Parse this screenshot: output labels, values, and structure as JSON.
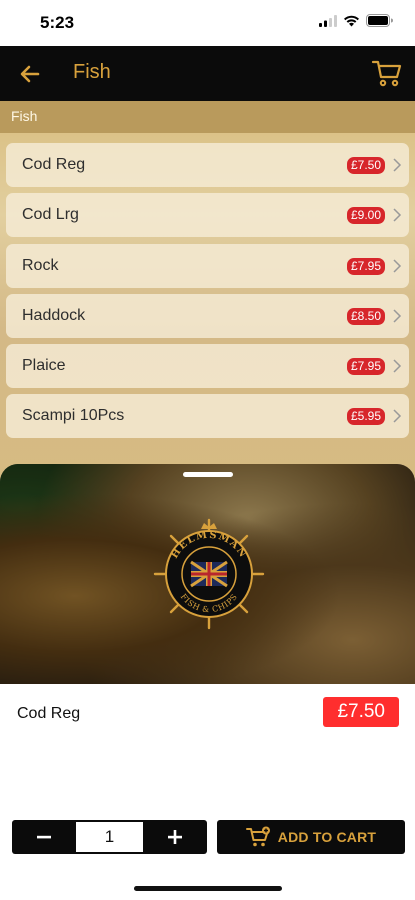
{
  "status_bar": {
    "time": "5:23"
  },
  "header": {
    "title": "Fish"
  },
  "category": {
    "label": "Fish"
  },
  "menu": {
    "items": [
      {
        "name": "Cod Reg",
        "price": "£7.50"
      },
      {
        "name": "Cod Lrg",
        "price": "£9.00"
      },
      {
        "name": "Rock",
        "price": "£7.95"
      },
      {
        "name": "Haddock",
        "price": "£8.50"
      },
      {
        "name": "Plaice",
        "price": "£7.95"
      },
      {
        "name": "Scampi 10Pcs",
        "price": "£5.95"
      }
    ]
  },
  "selected": {
    "name": "Cod Reg",
    "price": "£7.50",
    "quantity": "1",
    "logo_text_top": "HELMSMAN",
    "logo_text_bottom": "FISH & CHIPS"
  },
  "actions": {
    "add_to_cart": "ADD TO CART",
    "decrement": "−",
    "increment": "+"
  },
  "icons": {
    "back": "arrow-left-icon",
    "cart": "cart-icon",
    "chevron": "chevron-right-icon",
    "signal": "signal-icon",
    "wifi": "wifi-icon",
    "battery": "battery-icon"
  },
  "colors": {
    "accent": "#d8a13c",
    "header_bg": "#0b0b0b",
    "price_red": "#d7262b",
    "price_highlight": "#ff2e2e"
  }
}
